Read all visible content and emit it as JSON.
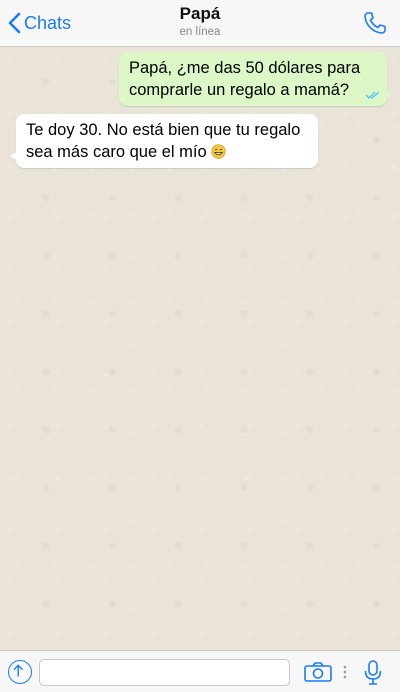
{
  "header": {
    "back_label": "Chats",
    "contact_name": "Papá",
    "status": "en línea"
  },
  "messages": [
    {
      "direction": "outgoing",
      "text": "Papá, ¿me das 50 dólares para comprarle un regalo a mamá?",
      "read_ticks": "double-check-icon"
    },
    {
      "direction": "incoming",
      "text": "Te doy 30. No está bien que tu regalo sea más caro que el mío",
      "emoji": "grinning-face-icon"
    }
  ],
  "input": {
    "placeholder": "",
    "value": ""
  },
  "colors": {
    "accent": "#1a7bf2",
    "outgoing_bubble": "#dcf8c6",
    "incoming_bubble": "#ffffff",
    "read_tick": "#4fc3f7"
  }
}
